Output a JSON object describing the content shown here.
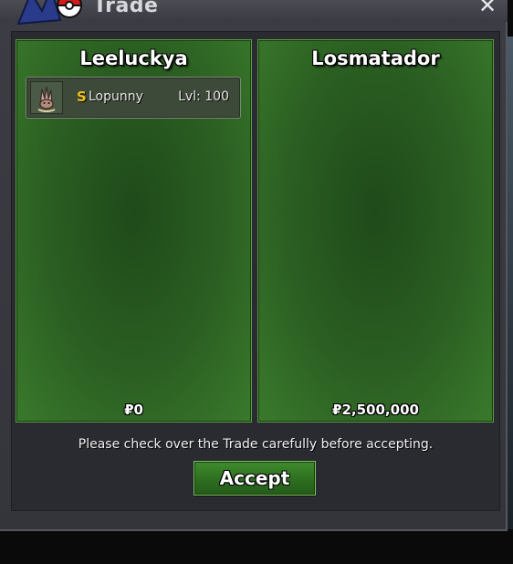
{
  "window": {
    "title": "Trade",
    "close_glyph": "✕"
  },
  "left_panel": {
    "trader_name": "Leeluckya",
    "items": [
      {
        "icon": "lopunny-sprite-icon",
        "shiny_mark": "S",
        "name": "Lopunny",
        "level": "Lvl: 100"
      }
    ],
    "money": "₽0"
  },
  "right_panel": {
    "trader_name": "Losmatador",
    "items": [],
    "money": "₽2,500,000"
  },
  "footer": {
    "notice": "Please check over the Trade carefully before accepting.",
    "accept_label": "Accept"
  },
  "colors": {
    "panel_green": "#2b5f22",
    "button_green": "#2e6e20",
    "shiny_gold": "#f2c21a",
    "window_bg": "#34353b"
  }
}
